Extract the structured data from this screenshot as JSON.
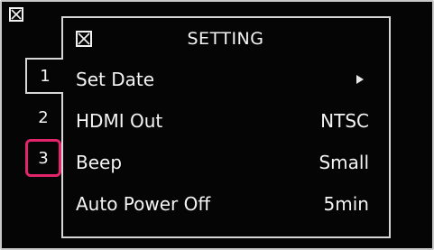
{
  "menu": {
    "title": "SETTING",
    "rows": [
      {
        "label": "Set Date",
        "value": ""
      },
      {
        "label": "HDMI Out",
        "value": "NTSC"
      },
      {
        "label": "Beep",
        "value": "Small"
      },
      {
        "label": "Auto Power Off",
        "value": "5min"
      }
    ]
  },
  "tabs": [
    "1",
    "2",
    "3"
  ],
  "highlight_color": "#e2246b"
}
